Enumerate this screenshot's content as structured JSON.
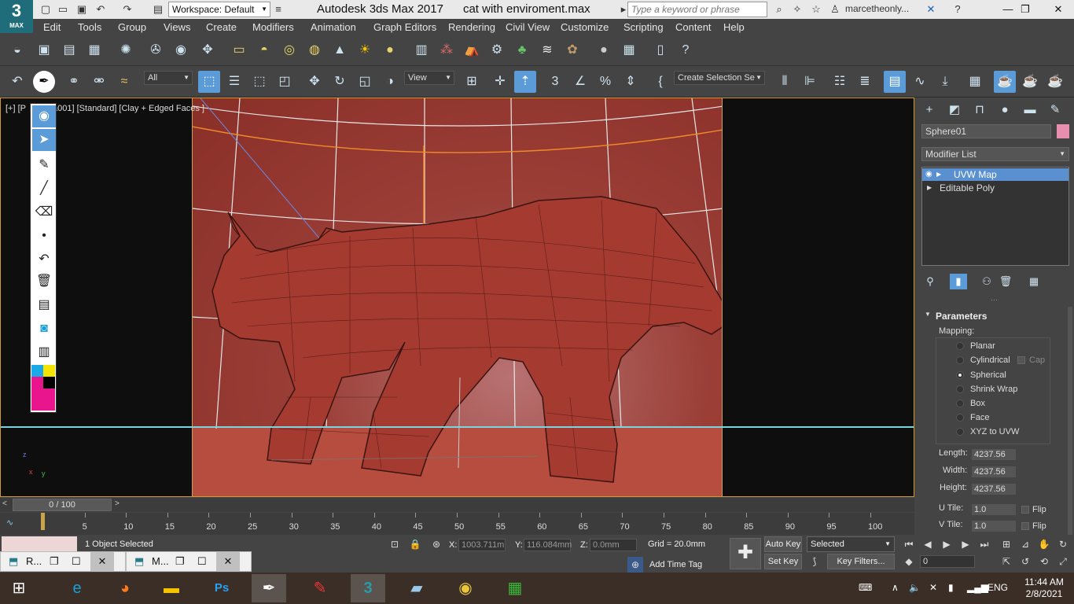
{
  "app": {
    "logo_big": "3",
    "logo_small": "MAX",
    "title": "Autodesk 3ds Max 2017",
    "file": "cat with enviroment.max",
    "workspace": "Workspace: Default",
    "search_placeholder": "Type a keyword or phrase",
    "user": "marcetheonly..."
  },
  "menu": [
    "Edit",
    "Tools",
    "Group",
    "Views",
    "Create",
    "Modifiers",
    "Animation",
    "Graph Editors",
    "Rendering",
    "Civil View",
    "Customize",
    "Scripting",
    "Content",
    "Help"
  ],
  "toolbar2": {
    "filter": "All",
    "ref_coord": "View",
    "selection_set": "Create Selection Se"
  },
  "viewport": {
    "label_a": "[+] [P",
    "label_b": "hera001] [Standard] [Clay + Edged Faces ]",
    "axis_x": "x",
    "axis_y": "y",
    "axis_z": "z"
  },
  "command_panel": {
    "object_name": "Sphere01",
    "object_color": "#e88fb0",
    "modifier_list": "Modifier List",
    "stack": [
      "UVW Map",
      "Editable Poly"
    ],
    "rollout_title": "Parameters",
    "mapping_label": "Mapping:",
    "mapping_options": [
      "Planar",
      "Cylindrical",
      "Spherical",
      "Shrink Wrap",
      "Box",
      "Face",
      "XYZ to UVW"
    ],
    "mapping_selected": "Spherical",
    "cap_label": "Cap",
    "length_label": "Length:",
    "length": "4237.56",
    "width_label": "Width:",
    "width": "4237.56",
    "height_label": "Height:",
    "height": "4237.56",
    "utile_label": "U Tile:",
    "utile": "1.0",
    "vtile_label": "V Tile:",
    "vtile": "1.0",
    "flip_label": "Flip"
  },
  "timeline": {
    "slider": "0 / 100",
    "ticks": [
      "5",
      "10",
      "15",
      "20",
      "25",
      "30",
      "35",
      "40",
      "45",
      "50",
      "55",
      "60",
      "65",
      "70",
      "75",
      "80",
      "85",
      "90",
      "95",
      "100"
    ]
  },
  "status": {
    "selected": "1 Object Selected",
    "x_label": "X:",
    "x": "1003.711m",
    "y_label": "Y:",
    "y": "116.084mm",
    "z_label": "Z:",
    "z": "0.0mm",
    "grid": "Grid = 20.0mm",
    "add_time_tag": "Add Time Tag",
    "auto_key": "Auto Key",
    "set_key": "Set Key",
    "key_mode": "Selected",
    "key_filters": "Key Filters...",
    "frame": "0"
  },
  "mini_windows": [
    {
      "label": "R..."
    },
    {
      "label": "M..."
    }
  ],
  "taskbar": {
    "lang": "ENG",
    "time": "11:44 AM",
    "date": "2/8/2021"
  }
}
